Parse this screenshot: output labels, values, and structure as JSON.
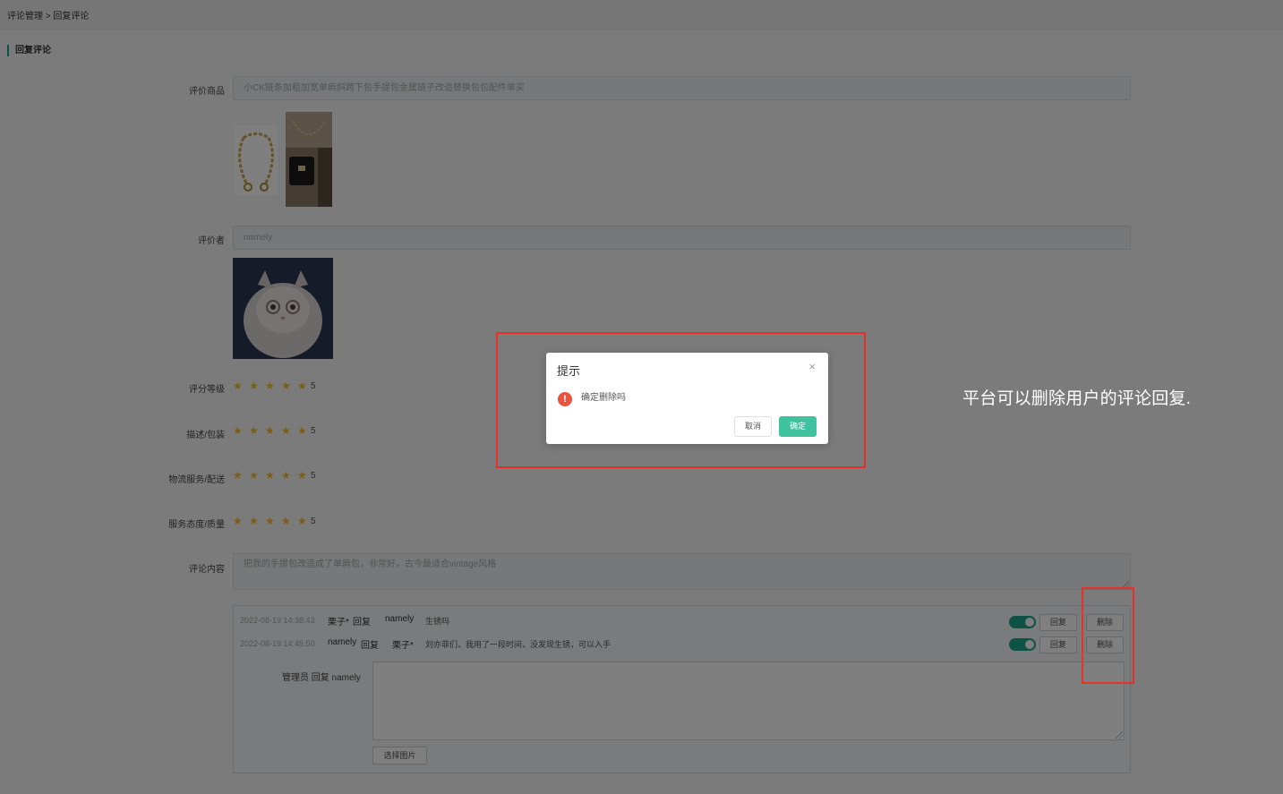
{
  "breadcrumb": "评论管理 > 回复评论",
  "section_title": "回复评论",
  "form": {
    "product_label": "评价商品",
    "product_value": "小CK链条加粗加宽单肩斜跨下包手提包金属链子改造替换包包配件单买",
    "reviewer_label": "评价者",
    "reviewer_value": "namely",
    "ratings": [
      {
        "label": "评分等级",
        "score": "5",
        "stars": 5
      },
      {
        "label": "描述/包装",
        "score": "5",
        "stars": 5
      },
      {
        "label": "物流服务/配送",
        "score": "5",
        "stars": 5
      },
      {
        "label": "服务态度/质量",
        "score": "5",
        "stars": 5
      }
    ],
    "content_label": "评论内容",
    "content_value": "把我的手提包改造成了单肩包，非常好，古今最适合vintage风格"
  },
  "replies": [
    {
      "time": "2022-08-19 14:38:43",
      "from": "栗子*",
      "verb": "回复",
      "to": "namely",
      "text": "生锈吗",
      "reply_label": "回复",
      "delete_label": "删除",
      "enabled": true
    },
    {
      "time": "2022-08-19 14:45:50",
      "from": "namely",
      "verb": "回复",
      "to": "栗子*",
      "text": "刘亦菲们，我用了一段时间，没发现生锈，可以入手",
      "reply_label": "回复",
      "delete_label": "删除",
      "enabled": true
    }
  ],
  "admin_reply": {
    "label": "管理员 回复 namely",
    "choose_image": "选择图片"
  },
  "dialog": {
    "title": "提示",
    "message": "确定删除吗",
    "close_icon": "×",
    "warning_icon": "!",
    "cancel": "取消",
    "ok": "确定"
  },
  "annotation": "平台可以删除用户的评论回复.",
  "colors": {
    "accent": "#1aa58a",
    "ok_button": "#3fc29f",
    "highlight": "#e8302a",
    "star": "#f7ba2a",
    "warning": "#e8543d"
  },
  "icons": {
    "star": "★",
    "close": "×",
    "warning": "!"
  }
}
